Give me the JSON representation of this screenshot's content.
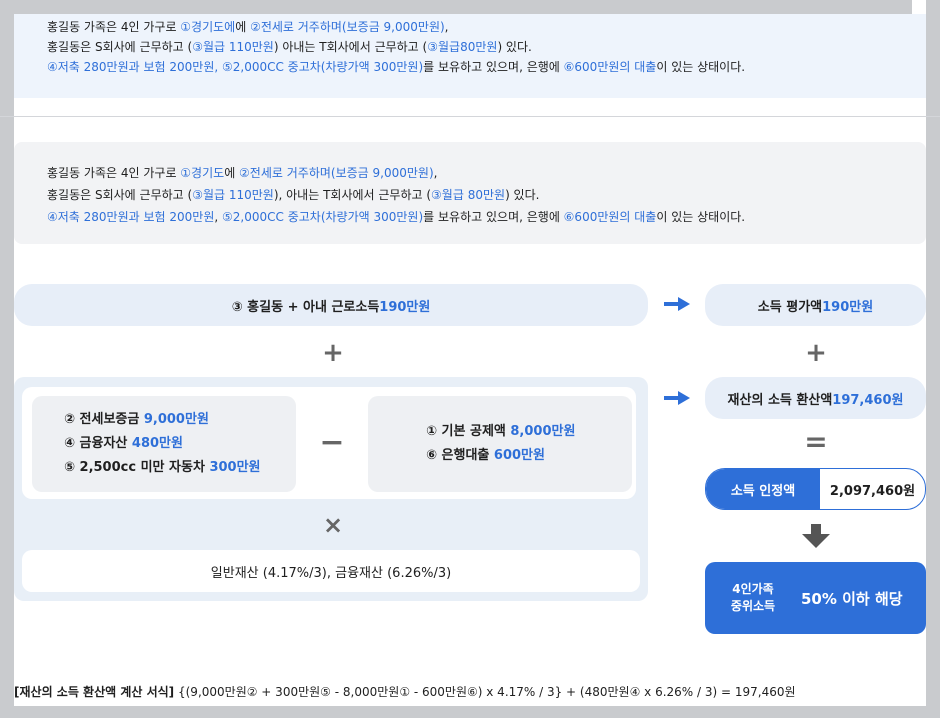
{
  "story_top": {
    "line1": [
      {
        "t": "홍길동 가족은 4인 가구로 ",
        "hl": false
      },
      {
        "t": "①경기도에",
        "hl": true
      },
      {
        "t": "에 ",
        "hl": false
      },
      {
        "t": "②전세로 거주하며(보증금 9,000만원)",
        "hl": true
      },
      {
        "t": ",",
        "hl": false
      }
    ],
    "line2": [
      {
        "t": "홍길동은 S회사에 근무하고 (",
        "hl": false
      },
      {
        "t": "③월급 110만원",
        "hl": true
      },
      {
        "t": ") 아내는 T회사에서 근무하고 (",
        "hl": false
      },
      {
        "t": "③월급80만원",
        "hl": true
      },
      {
        "t": ") 있다.",
        "hl": false
      }
    ],
    "line3": [
      {
        "t": "④저축 280만원과 보험 200만원, ⑤2,000CC 중고차(차량가액 300만원)",
        "hl": true
      },
      {
        "t": "를 보유하고 있으며, 은행에 ",
        "hl": false
      },
      {
        "t": "⑥600만원의 대출",
        "hl": true
      },
      {
        "t": "이 있는 상태이다.",
        "hl": false
      }
    ]
  },
  "story_mid": {
    "line1": [
      {
        "t": "홍길동 가족은 4인 가구로 ",
        "hl": false
      },
      {
        "t": "①경기도",
        "hl": true
      },
      {
        "t": "에 ",
        "hl": false
      },
      {
        "t": "②전세로 거주하며(보증금 9,000만원)",
        "hl": true
      },
      {
        "t": ",",
        "hl": false
      }
    ],
    "line2": [
      {
        "t": "홍길동은 S회사에 근무하고 (",
        "hl": false
      },
      {
        "t": "③월급 110만원",
        "hl": true
      },
      {
        "t": "), 아내는 T회사에서 근무하고 (",
        "hl": false
      },
      {
        "t": "③월급 80만원",
        "hl": true
      },
      {
        "t": ") 있다.",
        "hl": false
      }
    ],
    "line3": [
      {
        "t": "④저축 280만원과 보험 200만원",
        "hl": true
      },
      {
        "t": ", ",
        "hl": false
      },
      {
        "t": "⑤2,000CC 중고차(차량가액 300만원)",
        "hl": true
      },
      {
        "t": "를 보유하고 있으며, 은행에 ",
        "hl": false
      },
      {
        "t": "⑥600만원의 대출",
        "hl": true
      },
      {
        "t": "이 있는 상태이다.",
        "hl": false
      }
    ]
  },
  "income_pill": {
    "prefix": "③ 홍길동 + 아내 근로소득 ",
    "amount": "190만원"
  },
  "income_eval": {
    "prefix": "소득 평가액 ",
    "amount": "190만원"
  },
  "asset_conv": {
    "prefix": "재산의 소득 환산액 ",
    "amount": "197,460원"
  },
  "assets_card": [
    {
      "prefix": "② 전세보증금 ",
      "amount": "9,000만원"
    },
    {
      "prefix": "④ 금융자산 ",
      "amount": "480만원"
    },
    {
      "prefix": "⑤ 2,500cc 미만 자동차 ",
      "amount": "300만원"
    }
  ],
  "deduct_card": [
    {
      "prefix": "① 기본 공제액 ",
      "amount": "8,000만원"
    },
    {
      "prefix": "⑥ 은행대출 ",
      "amount": "600만원"
    }
  ],
  "rates_text": "일반재산 (4.17%/3), 금융재산 (6.26%/3)",
  "symbols": {
    "plus": "+",
    "minus": "−",
    "times": "×",
    "equals": "=",
    "down": "▼"
  },
  "recognized": {
    "label": "소득 인정액",
    "value": "2,097,460원"
  },
  "result": {
    "sub_line1": "4인가족",
    "sub_line2": "중위소득",
    "main": "50% 이하 해당"
  },
  "formula": {
    "label": "[재산의 소득 환산액 계산 서식]",
    "body": " {(9,000만원② + 300만원⑤ - 8,000만원① - 600만원⑥) x 4.17% / 3} + (480만원④ x 6.26% / 3) = 197,460원"
  },
  "colors": {
    "accent": "#2e6fd8",
    "pill_bg": "#e7eef8",
    "panel_bg": "#e8eff7"
  },
  "icons": {
    "arrow": "arrow-right-icon",
    "plus": "plus-icon",
    "minus": "minus-icon",
    "times": "times-icon",
    "equals": "equals-icon",
    "down": "arrow-down-icon"
  }
}
